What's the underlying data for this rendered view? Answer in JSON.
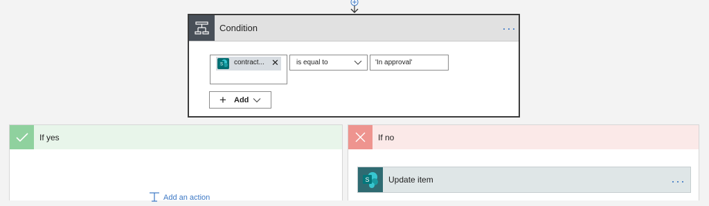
{
  "condition": {
    "title": "Condition",
    "more_label": "···",
    "token": {
      "label": "contract...",
      "remove_label": "✕"
    },
    "operator": {
      "value": "is equal to"
    },
    "value_field": {
      "value": "'In approval'"
    },
    "add_button": {
      "label": "Add"
    }
  },
  "branch_yes": {
    "title": "If yes",
    "add_action_label": "Add an action",
    "accent": "#8fd19e"
  },
  "branch_no": {
    "title": "If no",
    "accent": "#ee948f",
    "action": {
      "title": "Update item",
      "more_label": "···"
    }
  },
  "icons": {
    "condition": "condition-icon",
    "sharepoint": "sharepoint-icon",
    "check": "check-icon",
    "cross": "close-icon",
    "add_step": "add-step-icon"
  }
}
